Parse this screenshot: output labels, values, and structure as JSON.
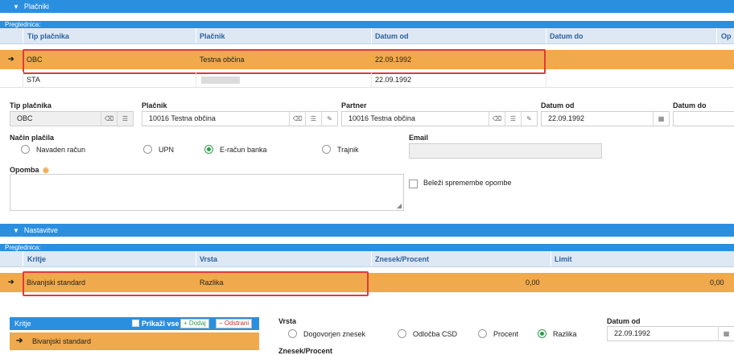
{
  "section_placniki": {
    "title": "Plačniki"
  },
  "grid1": {
    "label": "Preglednica:",
    "headers": [
      "Tip plačnika",
      "Plačnik",
      "Datum od",
      "Datum do",
      "Op"
    ],
    "rows": [
      {
        "tip": "OBC",
        "placnik": "Testna občina",
        "datum_od": "22.09.1992",
        "datum_do": ""
      },
      {
        "tip": "STA",
        "placnik": "",
        "datum_od": "22.09.1992",
        "datum_do": ""
      }
    ]
  },
  "form": {
    "tip_label": "Tip plačnika",
    "tip_value": "OBC",
    "placnik_label": "Plačnik",
    "placnik_value": "10016 Testna občina",
    "partner_label": "Partner",
    "partner_value": "10016 Testna občina",
    "datum_od_label": "Datum od",
    "datum_od_value": "22.09.1992",
    "datum_do_label": "Datum do",
    "datum_do_value": "",
    "nacin_label": "Način plačila",
    "nacin_options": [
      "Navaden račun",
      "UPN",
      "E-račun banka",
      "Trajnik"
    ],
    "nacin_selected": "E-račun banka",
    "email_label": "Email",
    "email_value": "",
    "opomba_label": "Opomba",
    "belezi_label": "Beleži spremembe opombe"
  },
  "section_nastavitve": {
    "title": "Nastavitve"
  },
  "grid2": {
    "label": "Preglednica:",
    "headers": [
      "Kritje",
      "Vrsta",
      "Znesek/Procent",
      "Limit"
    ],
    "rows": [
      {
        "kritje": "Bivanjski standard",
        "vrsta": "Razlika",
        "znesek": "0,00",
        "limit": "0,00"
      }
    ]
  },
  "kritje_panel": {
    "title": "Kritje",
    "prikazi_label": "Prikaži vse",
    "dodaj_label": "+ Dodaj",
    "odstrani_label": "− Odstrani",
    "items": [
      "Bivanjski standard"
    ]
  },
  "detail": {
    "vrsta_label": "Vrsta",
    "vrsta_options": [
      "Dogovorjen znesek",
      "Odločba CSD",
      "Procent",
      "Razlika"
    ],
    "vrsta_selected": "Razlika",
    "datum_od_label": "Datum od",
    "datum_od_value": "22.09.1992",
    "znesek_label": "Znesek/Procent"
  },
  "colors": {
    "accent": "#2b8fe0",
    "selected_row": "#f0a94c",
    "highlight": "#e03a3a",
    "radio_on": "#2e9c4a"
  }
}
